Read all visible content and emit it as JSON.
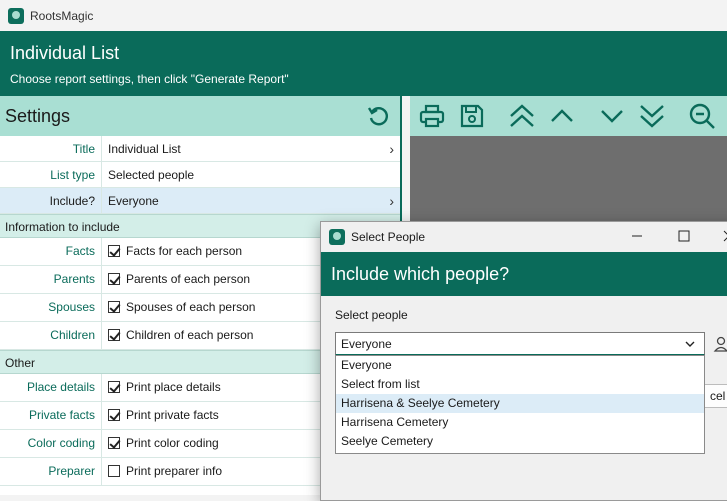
{
  "app": {
    "title": "RootsMagic"
  },
  "header": {
    "title": "Individual List",
    "subtitle": "Choose report settings, then click \"Generate Report\""
  },
  "settings": {
    "title": "Settings",
    "rows": [
      {
        "label": "Title",
        "value": "Individual List"
      },
      {
        "label": "List type",
        "value": "Selected people"
      },
      {
        "label": "Include?",
        "value": "Everyone"
      }
    ],
    "info_section": "Information to include",
    "info_rows": [
      {
        "label": "Facts",
        "value": "Facts for each person",
        "checked": true
      },
      {
        "label": "Parents",
        "value": "Parents of each person",
        "checked": true
      },
      {
        "label": "Spouses",
        "value": "Spouses of each person",
        "checked": true
      },
      {
        "label": "Children",
        "value": "Children of each person",
        "checked": true
      }
    ],
    "other_section": "Other",
    "other_rows": [
      {
        "label": "Place details",
        "value": "Print place details",
        "checked": true
      },
      {
        "label": "Private facts",
        "value": "Print private facts",
        "checked": true
      },
      {
        "label": "Color coding",
        "value": "Print color coding",
        "checked": true
      },
      {
        "label": "Preparer",
        "value": "Print preparer info",
        "checked": false
      }
    ]
  },
  "toolbar": {
    "icons": [
      "printer-icon",
      "save-icon",
      "double-chevron-up-icon",
      "chevron-up-icon",
      "chevron-down-icon",
      "double-chevron-down-icon",
      "zoom-out-icon"
    ]
  },
  "dialog": {
    "title": "Select People",
    "header": "Include which people?",
    "label": "Select people",
    "selected": "Everyone",
    "cancel_partial": "cel",
    "options": [
      "Everyone",
      "Select from list",
      "Harrisena & Seelye Cemetery",
      "Harrisena Cemetery",
      "Seelye Cemetery"
    ],
    "highlighted_index": 2
  },
  "colors": {
    "brand": "#0a6b5a",
    "panel_header": "#a9dfd3",
    "section": "#d3eee8",
    "selection": "#dcecf7"
  }
}
